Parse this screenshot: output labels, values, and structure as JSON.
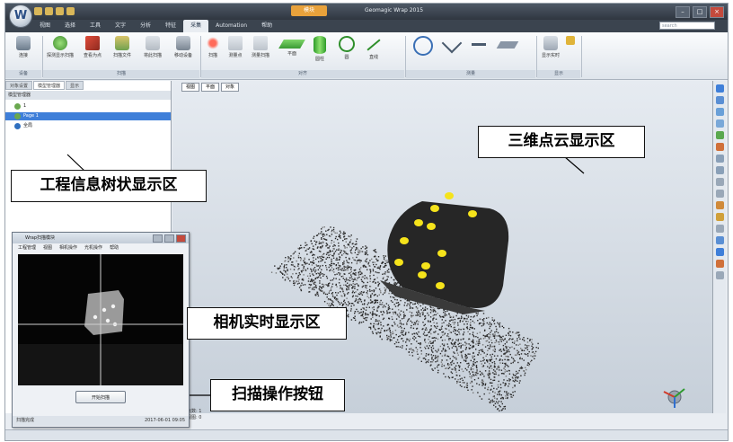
{
  "window": {
    "app_title": "模块",
    "title": "Geomagic Wrap 2015",
    "orb_letter": "W",
    "controls": [
      "–",
      "□",
      "×"
    ]
  },
  "ribbon_tabs": [
    "视图",
    "选择",
    "工具",
    "文字",
    "分析",
    "特征",
    "采集",
    "Automation",
    "帮助"
  ],
  "active_tab_index": 6,
  "search_placeholder": "search",
  "ribbon": {
    "buttons": [
      "连接",
      "探测显示扫描",
      "查看为点",
      "扫描文件",
      "将此扫描",
      "移动设备",
      "扫描",
      "测量点",
      "测量扫描",
      "平面",
      "圆柱",
      "圆",
      "直线",
      "",
      "",
      "",
      "",
      "显示实时"
    ],
    "groups": [
      "设备",
      "扫描",
      "对齐",
      "测量",
      "显示"
    ]
  },
  "left_panel": {
    "tabs": [
      "对象设置",
      "模型管理器",
      "显示"
    ],
    "header": "模型管理器",
    "tree": [
      {
        "label": "1",
        "color": "#6aa84f"
      },
      {
        "label": "Page 1",
        "color": "#6aa84f"
      },
      {
        "label": "全局",
        "color": "#2f6fbf"
      }
    ]
  },
  "viewport": {
    "tabs": [
      "视图",
      "平面",
      "对象"
    ],
    "info_lines": [
      "点数: 1",
      "视图: 0"
    ]
  },
  "camera_window": {
    "title": "Wrap扫描模块",
    "menu": [
      "工程管理",
      "视图",
      "相机操作",
      "光机操作",
      "帮助"
    ],
    "start_button": "开始扫描",
    "status_left": "扫描完成",
    "status_right": "2017-06-01 09:05"
  },
  "status_bar": "",
  "annotations": {
    "tree_area": "工程信息树状显示区",
    "point_cloud_area": "三维点云显示区",
    "camera_area": "相机实时显示区",
    "scan_button": "扫描操作按钮"
  },
  "colors": {
    "title_bar": "#2f3640",
    "accent": "#e9a23b",
    "selection": "#3f7fd9",
    "point_cloud": "#2a2a2a",
    "marker": "#f5e31b"
  }
}
